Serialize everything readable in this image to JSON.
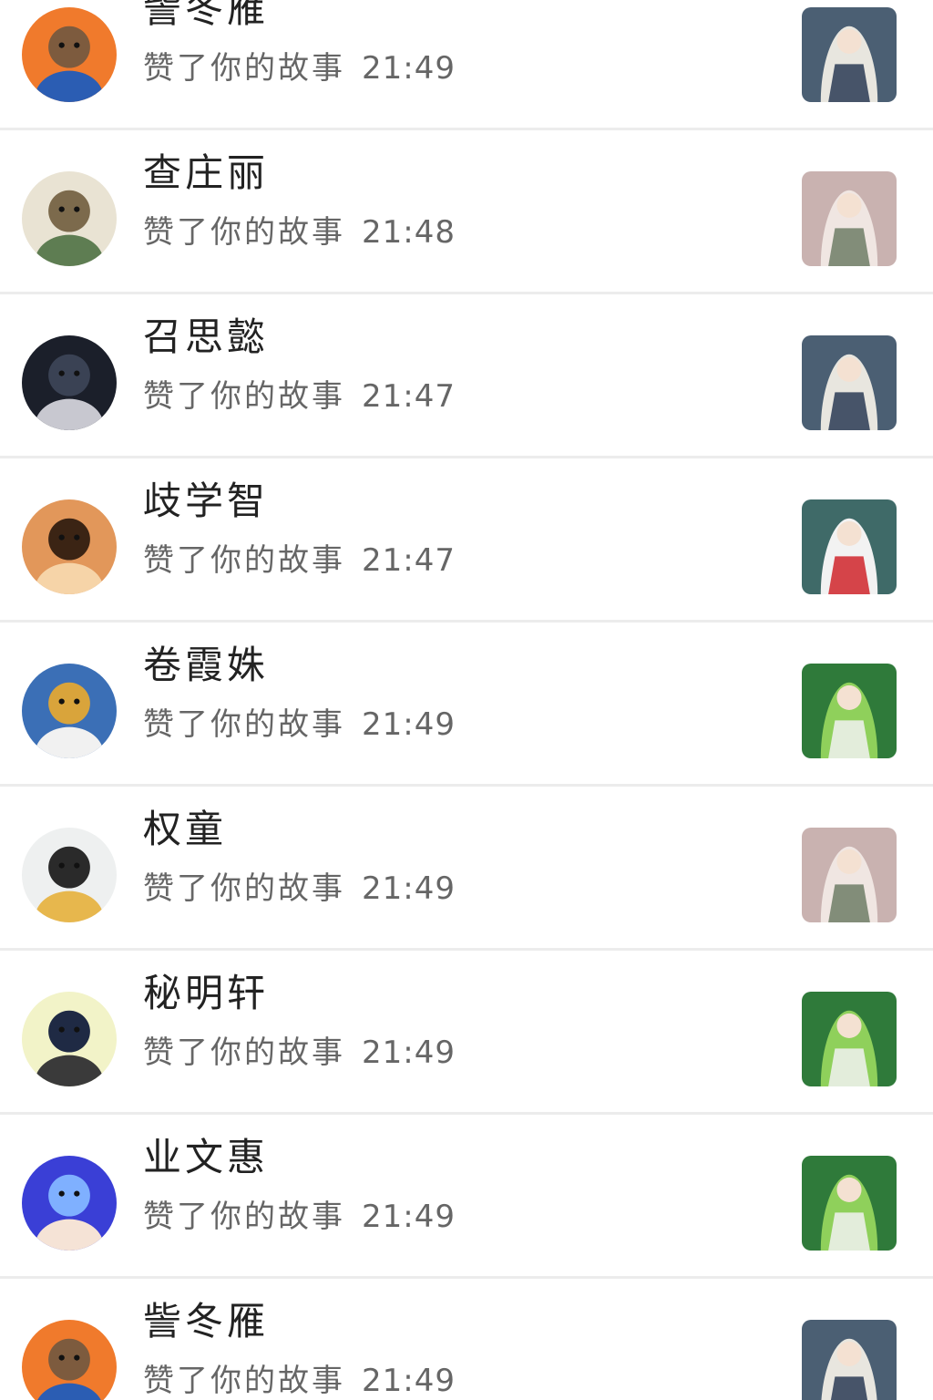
{
  "notifications": [
    {
      "name": "訾冬雁",
      "action": "赞了你的故事",
      "time": "21:49",
      "avatar_icon": "cartoon-character-avatar",
      "avatar_colors": [
        "#f07a2c",
        "#7d5b3e",
        "#2b5db3"
      ],
      "thumb_icon": "anime-girl-thumbnail",
      "thumb_colors": [
        "#4b5f73",
        "#e8e6df",
        "#2a3a55"
      ]
    },
    {
      "name": "查庄丽",
      "action": "赞了你的故事",
      "time": "21:48",
      "avatar_icon": "anime-boy-avatar",
      "avatar_colors": [
        "#e9e3d3",
        "#7c6a4c",
        "#5e7d52"
      ],
      "thumb_icon": "anime-girl-thumbnail",
      "thumb_colors": [
        "#c9b2b0",
        "#f0e6e2",
        "#6f7d66"
      ]
    },
    {
      "name": "召思懿",
      "action": "赞了你的故事",
      "time": "21:47",
      "avatar_icon": "dark-portrait-avatar",
      "avatar_colors": [
        "#1b1f2a",
        "#3a4254",
        "#c8c8d0"
      ],
      "thumb_icon": "anime-girl-thumbnail",
      "thumb_colors": [
        "#4b5f73",
        "#e8e6df",
        "#2a3a55"
      ]
    },
    {
      "name": "歧学智",
      "action": "赞了你的故事",
      "time": "21:47",
      "avatar_icon": "kitten-avatar",
      "avatar_colors": [
        "#e2975a",
        "#3b2414",
        "#f6d4a8"
      ],
      "thumb_icon": "anime-girl-red-dress-thumbnail",
      "thumb_colors": [
        "#3f6a68",
        "#f2f2f2",
        "#d0262b"
      ]
    },
    {
      "name": "卷霞姝",
      "action": "赞了你的故事",
      "time": "21:49",
      "avatar_icon": "bearded-warrior-avatar",
      "avatar_colors": [
        "#3b6fb6",
        "#d9a43b",
        "#f1f1f1"
      ],
      "thumb_icon": "anime-girl-green-thumbnail",
      "thumb_colors": [
        "#2f7a3a",
        "#8fd05b",
        "#f2f2f2"
      ]
    },
    {
      "name": "权童",
      "action": "赞了你的故事",
      "time": "21:49",
      "avatar_icon": "sketch-anime-avatar",
      "avatar_colors": [
        "#eef0f0",
        "#2a2a2a",
        "#e7b74d"
      ],
      "thumb_icon": "anime-girl-thumbnail",
      "thumb_colors": [
        "#c9b2b0",
        "#f0e6e2",
        "#6f7d66"
      ]
    },
    {
      "name": "秘明轩",
      "action": "赞了你的故事",
      "time": "21:49",
      "avatar_icon": "couple-avatar",
      "avatar_colors": [
        "#f2f3c8",
        "#1f2a44",
        "#3a3a3a"
      ],
      "thumb_icon": "anime-girl-green-thumbnail",
      "thumb_colors": [
        "#2f7a3a",
        "#8fd05b",
        "#f2f2f2"
      ]
    },
    {
      "name": "业文惠",
      "action": "赞了你的故事",
      "time": "21:49",
      "avatar_icon": "singer-avatar",
      "avatar_colors": [
        "#3a3fd6",
        "#7fb0ff",
        "#f5e3d6"
      ],
      "thumb_icon": "anime-girl-green-thumbnail",
      "thumb_colors": [
        "#2f7a3a",
        "#8fd05b",
        "#f2f2f2"
      ]
    },
    {
      "name": "訾冬雁",
      "action": "赞了你的故事",
      "time": "21:49",
      "avatar_icon": "cartoon-character-avatar",
      "avatar_colors": [
        "#f07a2c",
        "#7d5b3e",
        "#2b5db3"
      ],
      "thumb_icon": "anime-girl-thumbnail",
      "thumb_colors": [
        "#4b5f73",
        "#e8e6df",
        "#2a3a55"
      ]
    }
  ]
}
